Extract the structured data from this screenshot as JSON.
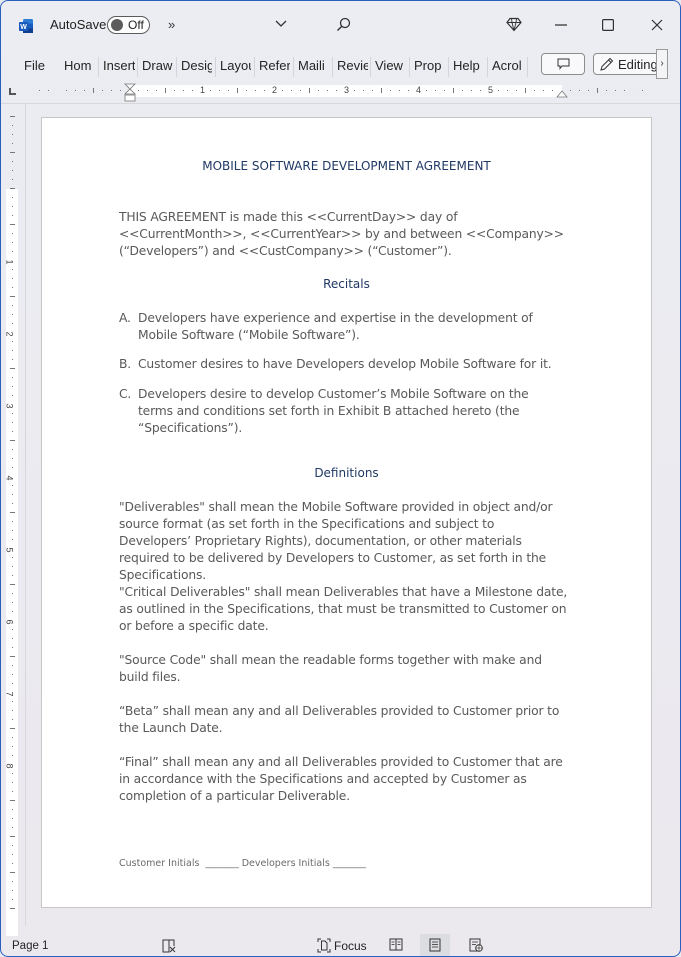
{
  "titlebar": {
    "app_icon": "word-logo-icon",
    "autosave_label": "AutoSave",
    "autosave_state": "Off",
    "more_commands": "»",
    "customize_dropdown": "chevron-down-icon",
    "search_icon": "search-icon",
    "premium_icon": "diamond-icon",
    "minimize": "—",
    "maximize": "☐",
    "close": "✕"
  },
  "ribbon": {
    "tabs": [
      "File",
      "Home",
      "Insert",
      "Draw",
      "Design",
      "Layout",
      "References",
      "Mailings",
      "Review",
      "View",
      "Properties",
      "Help",
      "Acrobat"
    ],
    "tabs_visible": [
      "File",
      "Hom ",
      "Insert",
      "Draw",
      "Desig",
      "Layou",
      "Refer",
      "Maili",
      "Revie",
      "View",
      "Prop ",
      "Help",
      "Acrol"
    ],
    "comments_button": "comment-icon",
    "editing_label": "Editing",
    "scroll_right": "›"
  },
  "ruler": {
    "horizontal_numbers": [
      "1",
      "2",
      "3",
      "4",
      "5"
    ],
    "vertical_numbers": [
      "1",
      "2",
      "3",
      "4",
      "5",
      "6",
      "7",
      "8"
    ]
  },
  "document": {
    "title": "MOBILE SOFTWARE DEVELOPMENT AGREEMENT",
    "intro": "THIS AGREEMENT is made this <<CurrentDay>> day of <<CurrentMonth>>, <<CurrentYear>> by and between <<Company>> (“Developers”) and <<CustCompany>> (“Customer”).",
    "recitals_heading": "Recitals",
    "recitals": [
      {
        "marker": "A.",
        "text": "Developers have experience and expertise in the development of Mobile Software (“Mobile Software”)."
      },
      {
        "marker": "B.",
        "text": "Customer desires to have Developers develop Mobile Software for it."
      },
      {
        "marker": "C.",
        "text": "Developers desire to develop Customer’s Mobile Software on the terms and conditions set forth in Exhibit B attached hereto (the “Specifications”)."
      }
    ],
    "definitions_heading": "Definitions",
    "definitions": [
      "\"Deliverables\" shall mean the Mobile Software provided in object and/or source format (as set forth in the Specifications and subject to Developers’ Proprietary Rights), documentation, or other materials required to be delivered by Developers to Customer, as set forth in the Specifications.",
      "\"Critical Deliverables\" shall mean Deliverables that have a Milestone date, as outlined in the Specifications, that must be transmitted to Customer on or before a specific date.",
      "\"Source Code\" shall mean the readable forms together with make and build files.",
      "“Beta” shall mean any and all Deliverables provided to Customer prior to the Launch Date.",
      "“Final” shall mean any and all Deliverables provided to Customer that are in accordance with the Specifications and accepted by Customer as completion of a particular Deliverable."
    ],
    "footer_initials": "Customer Initials  _______ Developers Initials _______"
  },
  "statusbar": {
    "page": "Page 1",
    "proofing_icon": "proofing-icon",
    "focus_label": "Focus",
    "views": [
      "read-mode-icon",
      "print-layout-icon",
      "web-layout-icon"
    ],
    "active_view": "print-layout"
  }
}
